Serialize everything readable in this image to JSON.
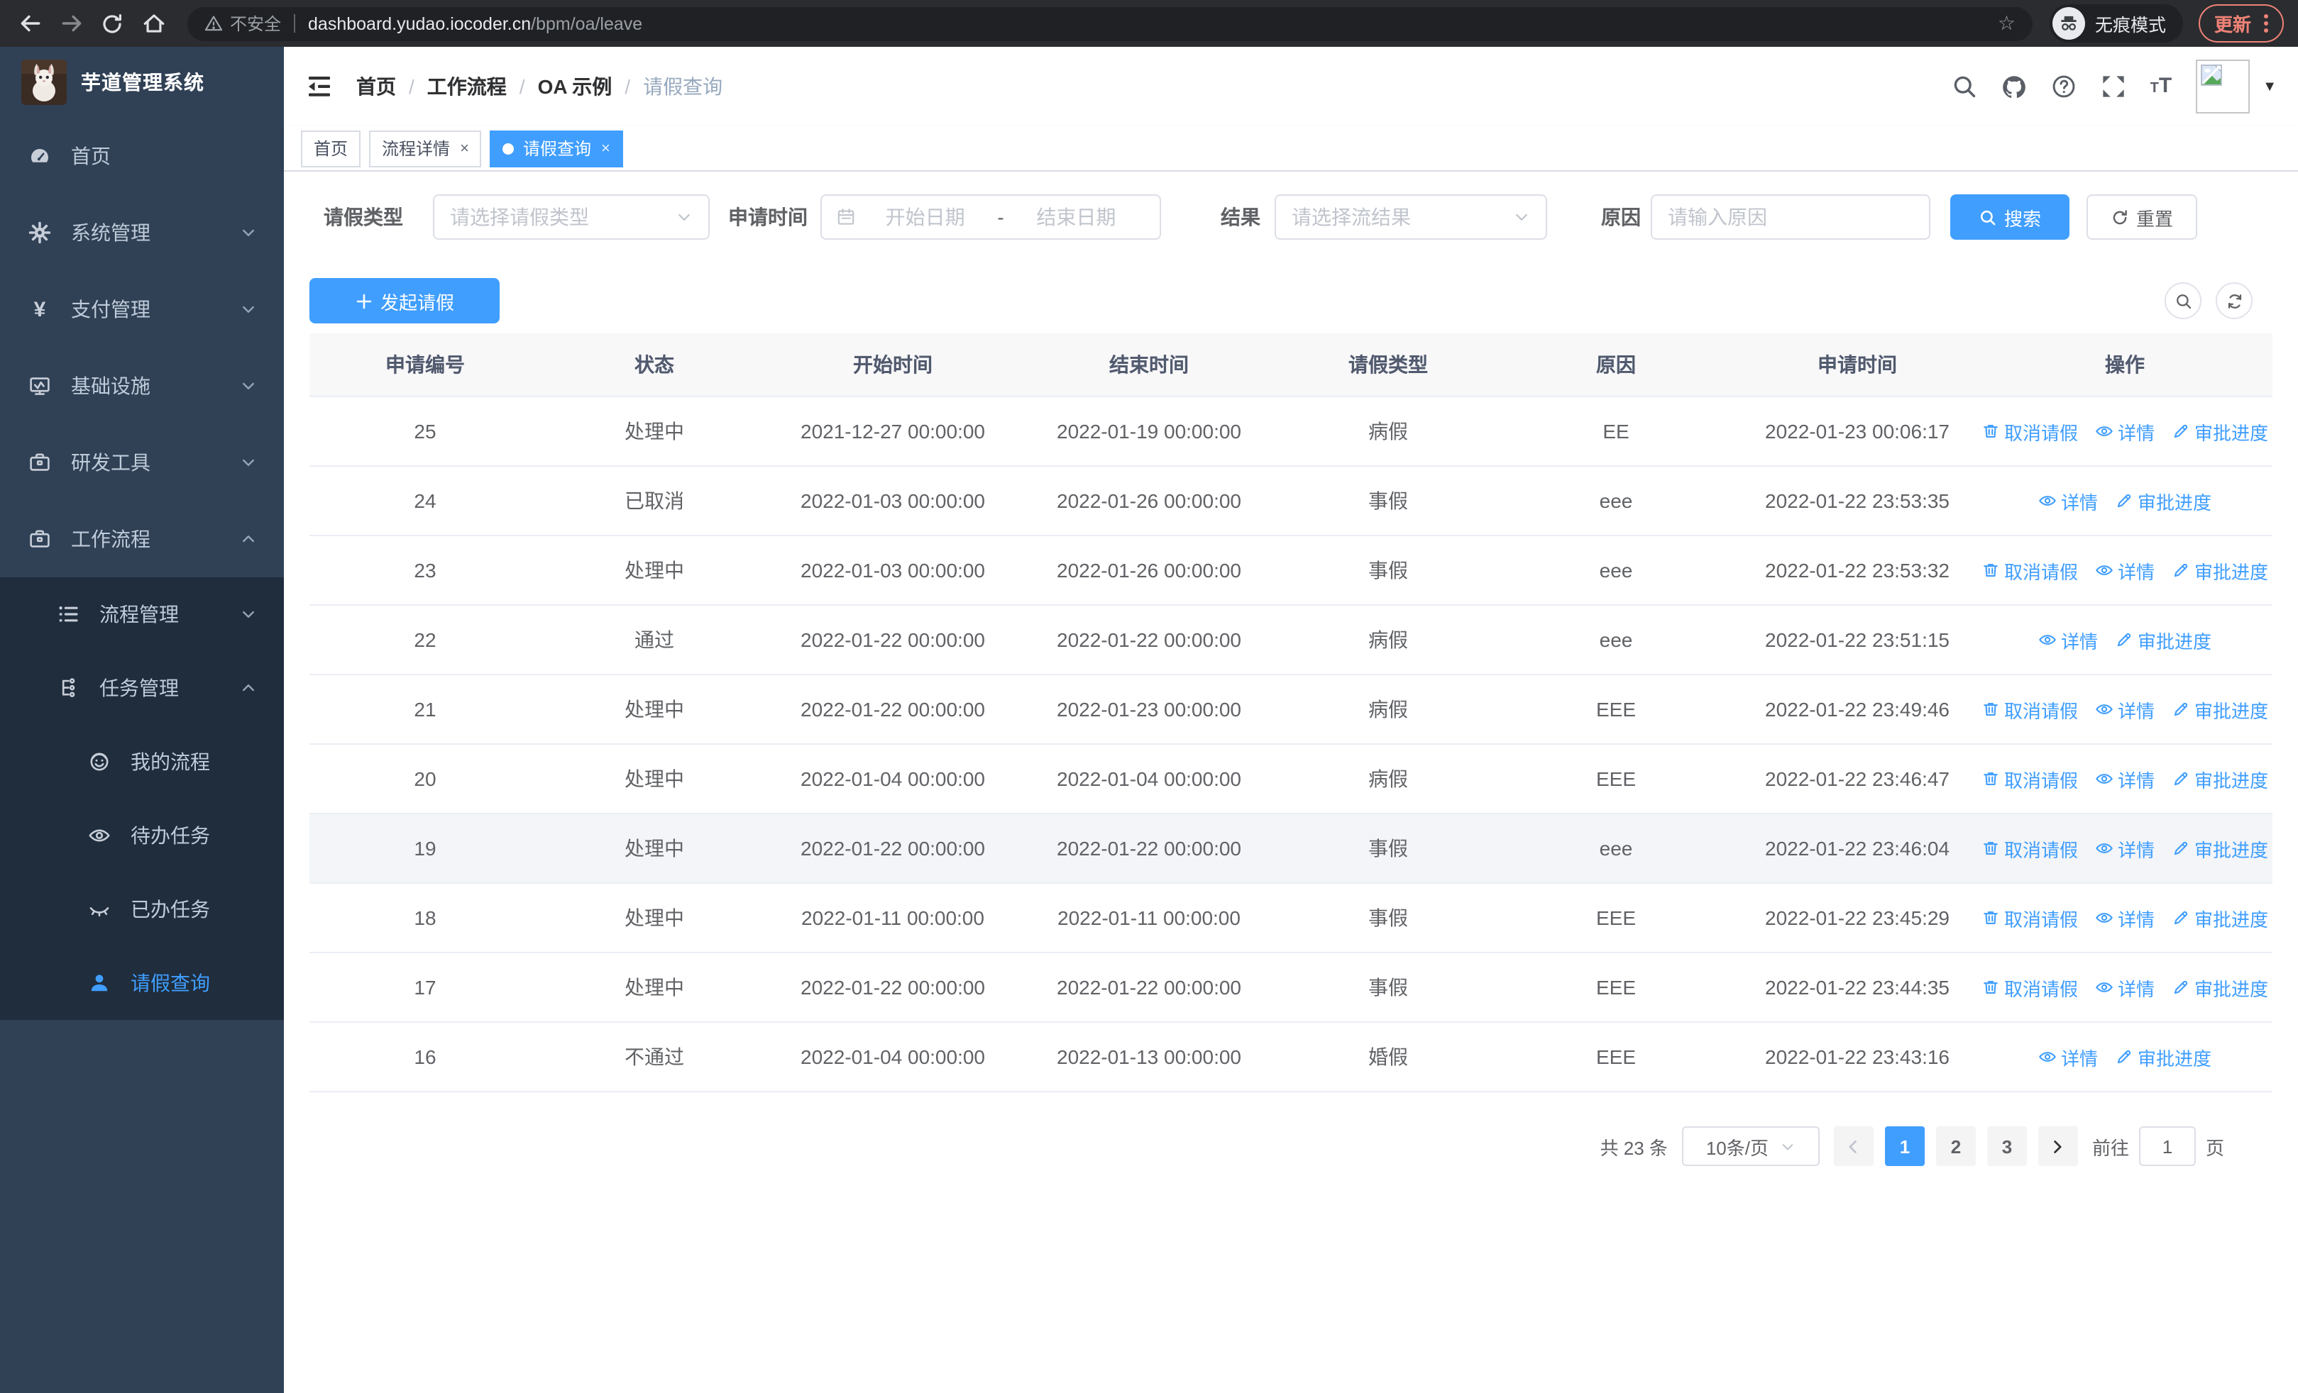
{
  "browser": {
    "security_label": "不安全",
    "url_host": "dashboard.yudao.iocoder.cn",
    "url_path": "/bpm/oa/leave",
    "incognito_label": "无痕模式",
    "update_label": "更新"
  },
  "app_title": "芋道管理系统",
  "sidebar": {
    "items": [
      {
        "key": "home",
        "label": "首页",
        "icon": "dashboard-icon",
        "level": 0,
        "expandable": false,
        "submenu": false,
        "active": false
      },
      {
        "key": "system",
        "label": "系统管理",
        "icon": "gear-icon",
        "level": 0,
        "expandable": true,
        "expanded": false,
        "submenu": false,
        "active": false
      },
      {
        "key": "payment",
        "label": "支付管理",
        "icon": "yen-icon",
        "level": 0,
        "expandable": true,
        "expanded": false,
        "submenu": false,
        "active": false
      },
      {
        "key": "infrastructure",
        "label": "基础设施",
        "icon": "monitor-icon",
        "level": 0,
        "expandable": true,
        "expanded": false,
        "submenu": false,
        "active": false
      },
      {
        "key": "dev-tools",
        "label": "研发工具",
        "icon": "toolbox-icon",
        "level": 0,
        "expandable": true,
        "expanded": false,
        "submenu": false,
        "active": false
      },
      {
        "key": "workflow",
        "label": "工作流程",
        "icon": "briefcase-icon",
        "level": 0,
        "expandable": true,
        "expanded": true,
        "submenu": false,
        "active": false
      },
      {
        "key": "process-mgmt",
        "label": "流程管理",
        "icon": "flow-list-icon",
        "level": 1,
        "expandable": true,
        "expanded": false,
        "submenu": true,
        "active": false
      },
      {
        "key": "task-mgmt",
        "label": "任务管理",
        "icon": "task-tree-icon",
        "level": 1,
        "expandable": true,
        "expanded": true,
        "submenu": true,
        "active": false
      },
      {
        "key": "my-process",
        "label": "我的流程",
        "icon": "face-icon",
        "level": 2,
        "expandable": false,
        "submenu": true,
        "active": false
      },
      {
        "key": "todo-tasks",
        "label": "待办任务",
        "icon": "eye-open-icon",
        "level": 2,
        "expandable": false,
        "submenu": true,
        "active": false
      },
      {
        "key": "done-tasks",
        "label": "已办任务",
        "icon": "eye-closed-icon",
        "level": 2,
        "expandable": false,
        "submenu": true,
        "active": false
      },
      {
        "key": "leave-query",
        "label": "请假查询",
        "icon": "user-icon",
        "level": 2,
        "expandable": false,
        "submenu": true,
        "active": true
      }
    ]
  },
  "breadcrumb": [
    "首页",
    "工作流程",
    "OA 示例",
    "请假查询"
  ],
  "tabs": [
    {
      "label": "首页",
      "closable": false,
      "active": false
    },
    {
      "label": "流程详情",
      "closable": true,
      "active": false
    },
    {
      "label": "请假查询",
      "closable": true,
      "active": true
    }
  ],
  "filters": {
    "leave_type_label": "请假类型",
    "leave_type_placeholder": "请选择请假类型",
    "apply_time_label": "申请时间",
    "date_start_placeholder": "开始日期",
    "date_separator": "-",
    "date_end_placeholder": "结束日期",
    "result_label": "结果",
    "result_placeholder": "请选择流结果",
    "reason_label": "原因",
    "reason_placeholder": "请输入原因",
    "search_label": "搜索",
    "reset_label": "重置"
  },
  "toolbar": {
    "create_label": "发起请假"
  },
  "table": {
    "columns": [
      "申请编号",
      "状态",
      "开始时间",
      "结束时间",
      "请假类型",
      "原因",
      "申请时间",
      "操作"
    ],
    "rows": [
      {
        "id": "25",
        "status": "处理中",
        "start": "2021-12-27 00:00:00",
        "end": "2022-01-19 00:00:00",
        "type": "病假",
        "reason": "EE",
        "applied": "2022-01-23 00:06:17",
        "highlighted": false,
        "actions": [
          {
            "label": "取消请假",
            "icon": "trash-icon"
          },
          {
            "label": "详情",
            "icon": "eye-icon"
          },
          {
            "label": "审批进度",
            "icon": "pen-icon"
          }
        ]
      },
      {
        "id": "24",
        "status": "已取消",
        "start": "2022-01-03 00:00:00",
        "end": "2022-01-26 00:00:00",
        "type": "事假",
        "reason": "eee",
        "applied": "2022-01-22 23:53:35",
        "highlighted": false,
        "actions": [
          {
            "label": "详情",
            "icon": "eye-icon"
          },
          {
            "label": "审批进度",
            "icon": "pen-icon"
          }
        ]
      },
      {
        "id": "23",
        "status": "处理中",
        "start": "2022-01-03 00:00:00",
        "end": "2022-01-26 00:00:00",
        "type": "事假",
        "reason": "eee",
        "applied": "2022-01-22 23:53:32",
        "highlighted": false,
        "actions": [
          {
            "label": "取消请假",
            "icon": "trash-icon"
          },
          {
            "label": "详情",
            "icon": "eye-icon"
          },
          {
            "label": "审批进度",
            "icon": "pen-icon"
          }
        ]
      },
      {
        "id": "22",
        "status": "通过",
        "start": "2022-01-22 00:00:00",
        "end": "2022-01-22 00:00:00",
        "type": "病假",
        "reason": "eee",
        "applied": "2022-01-22 23:51:15",
        "highlighted": false,
        "actions": [
          {
            "label": "详情",
            "icon": "eye-icon"
          },
          {
            "label": "审批进度",
            "icon": "pen-icon"
          }
        ]
      },
      {
        "id": "21",
        "status": "处理中",
        "start": "2022-01-22 00:00:00",
        "end": "2022-01-23 00:00:00",
        "type": "病假",
        "reason": "EEE",
        "applied": "2022-01-22 23:49:46",
        "highlighted": false,
        "actions": [
          {
            "label": "取消请假",
            "icon": "trash-icon"
          },
          {
            "label": "详情",
            "icon": "eye-icon"
          },
          {
            "label": "审批进度",
            "icon": "pen-icon"
          }
        ]
      },
      {
        "id": "20",
        "status": "处理中",
        "start": "2022-01-04 00:00:00",
        "end": "2022-01-04 00:00:00",
        "type": "病假",
        "reason": "EEE",
        "applied": "2022-01-22 23:46:47",
        "highlighted": false,
        "actions": [
          {
            "label": "取消请假",
            "icon": "trash-icon"
          },
          {
            "label": "详情",
            "icon": "eye-icon"
          },
          {
            "label": "审批进度",
            "icon": "pen-icon"
          }
        ]
      },
      {
        "id": "19",
        "status": "处理中",
        "start": "2022-01-22 00:00:00",
        "end": "2022-01-22 00:00:00",
        "type": "事假",
        "reason": "eee",
        "applied": "2022-01-22 23:46:04",
        "highlighted": true,
        "actions": [
          {
            "label": "取消请假",
            "icon": "trash-icon"
          },
          {
            "label": "详情",
            "icon": "eye-icon"
          },
          {
            "label": "审批进度",
            "icon": "pen-icon"
          }
        ]
      },
      {
        "id": "18",
        "status": "处理中",
        "start": "2022-01-11 00:00:00",
        "end": "2022-01-11 00:00:00",
        "type": "事假",
        "reason": "EEE",
        "applied": "2022-01-22 23:45:29",
        "highlighted": false,
        "actions": [
          {
            "label": "取消请假",
            "icon": "trash-icon"
          },
          {
            "label": "详情",
            "icon": "eye-icon"
          },
          {
            "label": "审批进度",
            "icon": "pen-icon"
          }
        ]
      },
      {
        "id": "17",
        "status": "处理中",
        "start": "2022-01-22 00:00:00",
        "end": "2022-01-22 00:00:00",
        "type": "事假",
        "reason": "EEE",
        "applied": "2022-01-22 23:44:35",
        "highlighted": false,
        "actions": [
          {
            "label": "取消请假",
            "icon": "trash-icon"
          },
          {
            "label": "详情",
            "icon": "eye-icon"
          },
          {
            "label": "审批进度",
            "icon": "pen-icon"
          }
        ]
      },
      {
        "id": "16",
        "status": "不通过",
        "start": "2022-01-04 00:00:00",
        "end": "2022-01-13 00:00:00",
        "type": "婚假",
        "reason": "EEE",
        "applied": "2022-01-22 23:43:16",
        "highlighted": false,
        "actions": [
          {
            "label": "详情",
            "icon": "eye-icon"
          },
          {
            "label": "审批进度",
            "icon": "pen-icon"
          }
        ]
      }
    ]
  },
  "pagination": {
    "total_label": "共 23 条",
    "page_size": "10条/页",
    "pages": [
      "1",
      "2",
      "3"
    ],
    "active_page": "1",
    "goto_label": "前往",
    "goto_value": "1",
    "page_suffix": "页"
  },
  "colors": {
    "primary": "#409eff",
    "sidebar_bg": "#304156",
    "submenu_bg": "#1f2d3d",
    "update_accent": "#ee8277"
  }
}
